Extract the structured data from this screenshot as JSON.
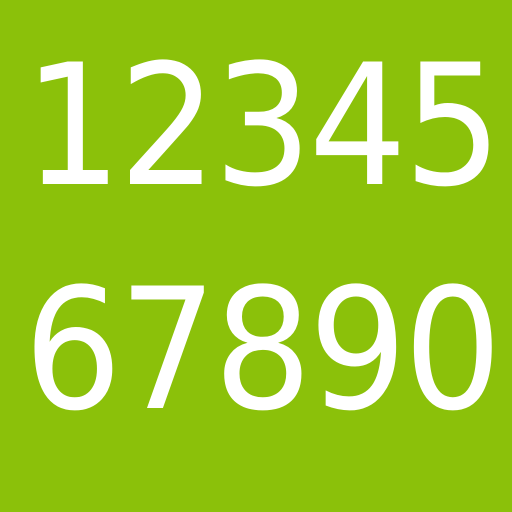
{
  "colors": {
    "background": "#8bc10a",
    "digits": "#ffffff"
  },
  "rows": [
    {
      "digits": [
        "1",
        "2",
        "3",
        "4",
        "5"
      ]
    },
    {
      "digits": [
        "6",
        "7",
        "8",
        "9",
        "0"
      ]
    }
  ]
}
